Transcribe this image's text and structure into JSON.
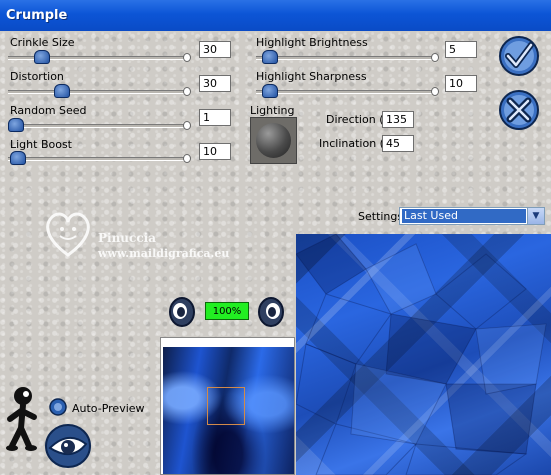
{
  "window": {
    "title": "Crumple"
  },
  "params_left": [
    {
      "label": "Crinkle Size",
      "value": "30",
      "level": 0.12
    },
    {
      "label": "Distortion",
      "value": "30",
      "level": 0.28
    },
    {
      "label": "Random Seed",
      "value": "1",
      "level": 0.0
    },
    {
      "label": "Light Boost",
      "value": "10",
      "level": 0.05
    }
  ],
  "params_right": [
    {
      "label": "Highlight Brightness",
      "value": "5",
      "level": 0.05
    },
    {
      "label": "Highlight Sharpness",
      "value": "10",
      "level": 0.05
    }
  ],
  "lighting": {
    "label": "Lighting",
    "direction_label": "Direction (°)",
    "direction_value": "135",
    "inclination_label": "Inclination (°)",
    "inclination_value": "45"
  },
  "settings": {
    "label": "Settings:",
    "value": "Last Used"
  },
  "watermark": {
    "name": "Pinuccia",
    "url": "www.maildigrafica.eu"
  },
  "zoom": {
    "value": "100%"
  },
  "auto_preview": {
    "label": "Auto-Preview"
  },
  "colors": {
    "titlebar": "#0c55d6",
    "accent": "#2a5fb0",
    "zoom_bg": "#22ee22",
    "selection": "#316ac5"
  },
  "icons": [
    "ok-check-icon",
    "cancel-x-icon",
    "zoom-in-icon",
    "zoom-out-icon",
    "help-figure-icon",
    "eye-icon"
  ]
}
